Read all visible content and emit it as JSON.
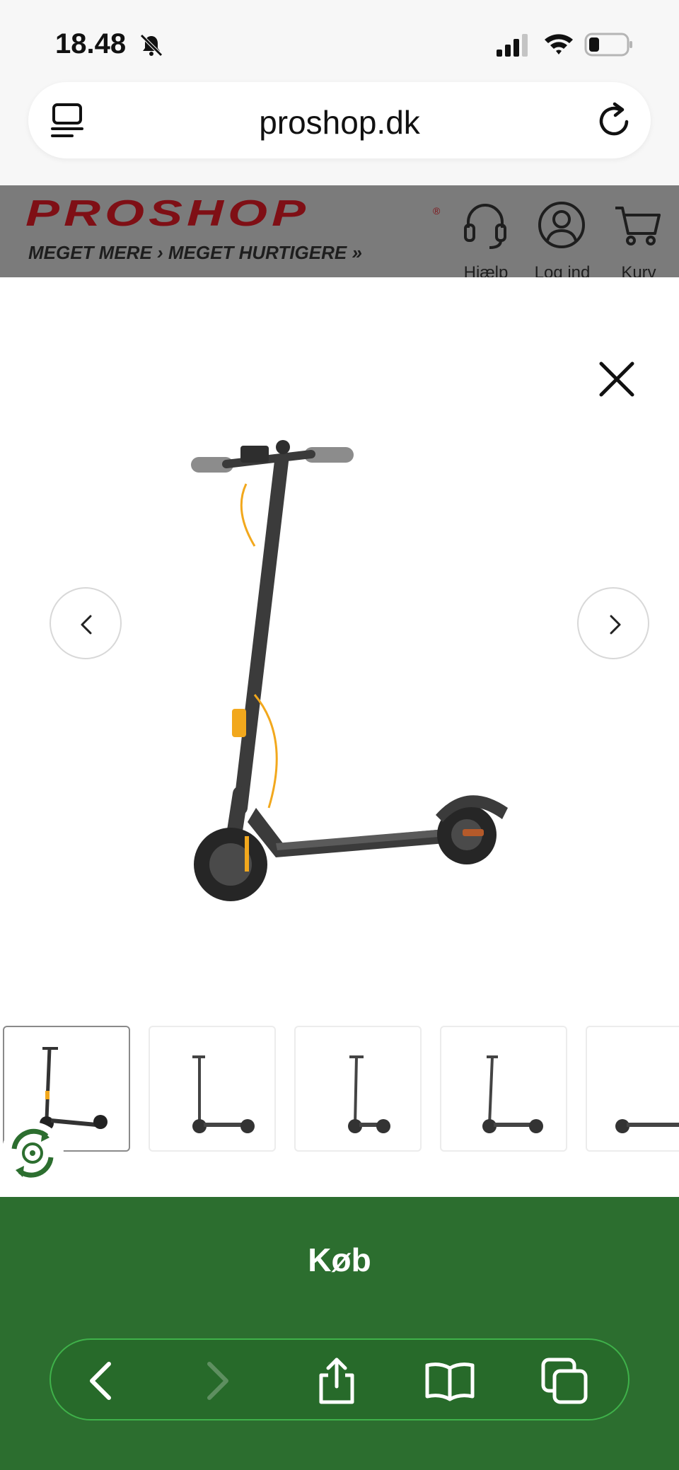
{
  "status_bar": {
    "time": "18.48"
  },
  "browser": {
    "url": "proshop.dk"
  },
  "site_header": {
    "logo": "PROSHOP",
    "tagline": "MEGET MERE › MEGET HURTIGERE »",
    "actions": [
      {
        "label": "Hjælp",
        "icon": "headset-icon"
      },
      {
        "label": "Log ind",
        "icon": "user-icon"
      },
      {
        "label": "Kurv",
        "icon": "cart-icon"
      }
    ]
  },
  "gallery": {
    "thumbnail_count": 5,
    "selected_thumbnail": 1
  },
  "buy": {
    "label": "Køb"
  },
  "colors": {
    "buy_green": "#2c6e2f",
    "brand_red": "#c8141e",
    "accent_yellow": "#f2a81d"
  }
}
